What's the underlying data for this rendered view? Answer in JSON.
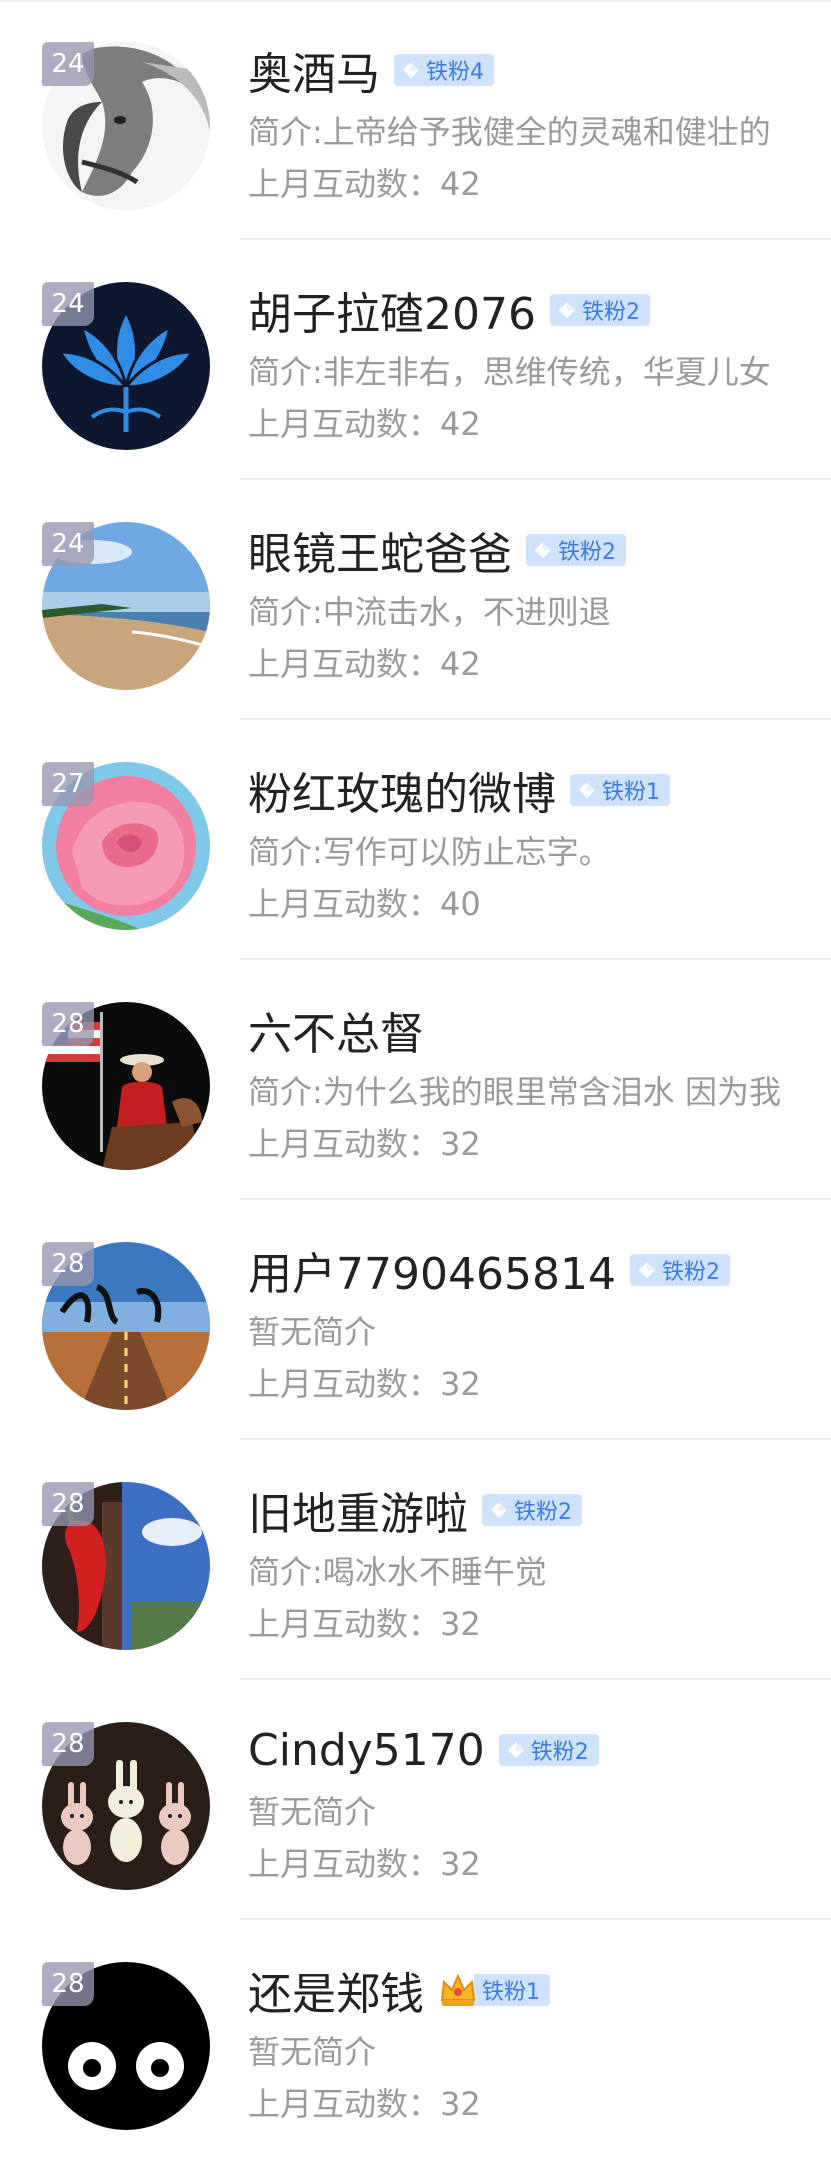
{
  "stat_label": "上月互动数：",
  "users": [
    {
      "rank": "24",
      "name": "奥酒马",
      "badge": {
        "type": "diamond",
        "label": "铁粉4"
      },
      "intro": "简介:上帝给予我健全的灵魂和健壮的",
      "count": "42",
      "avatar": "horse-avatar"
    },
    {
      "rank": "24",
      "name": "胡子拉碴2076",
      "badge": {
        "type": "diamond",
        "label": "铁粉2"
      },
      "intro": "简介:非左非右，思维传统，华夏儿女",
      "count": "42",
      "avatar": "lotus-avatar"
    },
    {
      "rank": "24",
      "name": "眼镜王蛇爸爸",
      "badge": {
        "type": "diamond",
        "label": "铁粉2"
      },
      "intro": "简介:中流击水，不进则退",
      "count": "42",
      "avatar": "beach-avatar"
    },
    {
      "rank": "27",
      "name": "粉红玫瑰的微博",
      "badge": {
        "type": "diamond",
        "label": "铁粉1"
      },
      "intro": "简介:写作可以防止忘字。",
      "count": "40",
      "avatar": "rose-avatar"
    },
    {
      "rank": "28",
      "name": "六不总督",
      "badge": null,
      "intro": "简介:为什么我的眼里常含泪水 因为我",
      "count": "32",
      "avatar": "cowboy-avatar"
    },
    {
      "rank": "28",
      "name": "用户7790465814",
      "badge": {
        "type": "diamond",
        "label": "铁粉2"
      },
      "intro": "暂无简介",
      "count": "32",
      "avatar": "faith-avatar"
    },
    {
      "rank": "28",
      "name": "旧地重游啦",
      "badge": {
        "type": "diamond",
        "label": "铁粉2"
      },
      "intro": "简介:喝冰水不睡午觉",
      "count": "32",
      "avatar": "pepper-avatar"
    },
    {
      "rank": "28",
      "name": "Cindy5170",
      "badge": {
        "type": "diamond",
        "label": "铁粉2"
      },
      "intro": "暂无简介",
      "count": "32",
      "avatar": "bunnies-avatar"
    },
    {
      "rank": "28",
      "name": "还是郑钱",
      "badge": {
        "type": "crown",
        "label": "铁粉1"
      },
      "intro": "暂无简介",
      "count": "32",
      "avatar": "eyes-avatar"
    }
  ]
}
